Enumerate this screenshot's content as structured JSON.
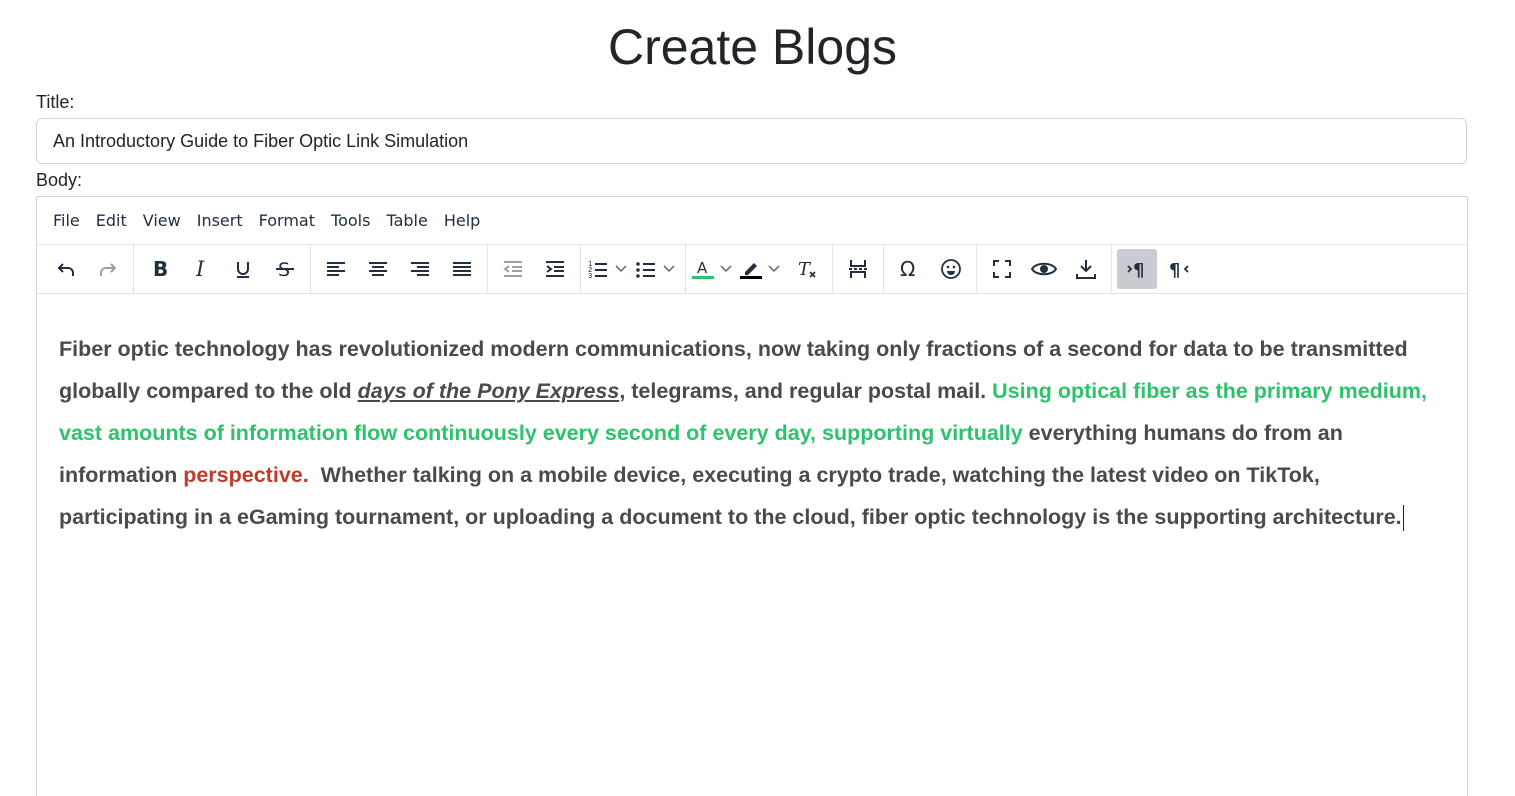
{
  "page": {
    "title": "Create Blogs"
  },
  "form": {
    "title_label": "Title:",
    "title_value": "An Introductory Guide to Fiber Optic Link Simulation",
    "body_label": "Body:"
  },
  "editor": {
    "menu": [
      "File",
      "Edit",
      "View",
      "Insert",
      "Format",
      "Tools",
      "Table",
      "Help"
    ],
    "toolbar_icons": [
      "undo-icon",
      "redo-icon",
      "bold-icon",
      "italic-icon",
      "underline-icon",
      "strikethrough-icon",
      "align-left-icon",
      "align-center-icon",
      "align-right-icon",
      "align-justify-icon",
      "outdent-icon",
      "indent-icon",
      "numbered-list-icon",
      "bullet-list-icon",
      "text-color-icon",
      "highlight-color-icon",
      "clear-formatting-icon",
      "page-break-icon",
      "special-character-icon",
      "emoticons-icon",
      "fullscreen-icon",
      "preview-icon",
      "save-icon",
      "ltr-icon",
      "rtl-icon"
    ],
    "colors": {
      "text_color_swatch": "#2dc26b",
      "highlight_swatch": "#000000",
      "green_text": "#2dc26b",
      "red_text": "#c0392b"
    },
    "content": {
      "seg1": "Fiber optic technology has revolutionized modern communications, now taking only fractions of a second for data to be transmitted globally compared to the old ",
      "seg2_link": "days of the Pony Express",
      "seg3": ", telegrams, and regular postal mail. ",
      "seg4_green": "Using optical fiber as the primary medium, vast amounts of information flow continuously every second of every day, supporting virtually",
      "seg5": " everything humans do from an information ",
      "seg6_red": "perspective.",
      "seg7": "  Whether talking on a mobile device, executing a crypto trade, watching the latest video on TikTok, participating in a eGaming tournament, or uploading a document to the cloud, fiber optic technology is the supporting architecture."
    }
  }
}
